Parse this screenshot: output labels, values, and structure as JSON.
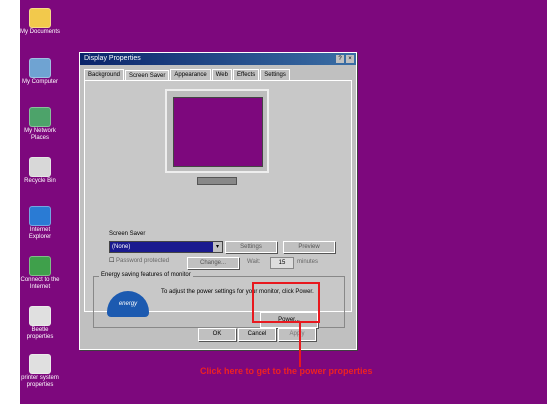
{
  "desktop": {
    "icons": [
      {
        "label": "My Documents",
        "icon": "folder-icon",
        "color": "#f2c94c"
      },
      {
        "label": "My Computer",
        "icon": "computer-icon",
        "color": "#6fa3d2"
      },
      {
        "label": "My Network Places",
        "icon": "network-icon",
        "color": "#4da36a"
      },
      {
        "label": "Recycle Bin",
        "icon": "recycle-bin-icon",
        "color": "#d8d8d8"
      },
      {
        "label": "Internet Explorer",
        "icon": "internet-explorer-icon",
        "color": "#2a7bd4"
      },
      {
        "label": "Connect to the Internet",
        "icon": "connect-internet-icon",
        "color": "#3fa04b"
      },
      {
        "label": "Beetle properties",
        "icon": "beetle-icon",
        "color": "#e0e0e0"
      },
      {
        "label": "printer system properties",
        "icon": "printer-icon",
        "color": "#e0e0e0"
      }
    ]
  },
  "dialog": {
    "title": "Display Properties",
    "title_buttons": [
      "?",
      "×"
    ],
    "tabs": [
      "Background",
      "Screen Saver",
      "Appearance",
      "Web",
      "Effects",
      "Settings"
    ],
    "active_tab": "Screen Saver",
    "screen_saver_label": "Screen Saver",
    "screen_saver_value": "(None)",
    "settings_button": "Settings",
    "preview_button": "Preview",
    "password_protected_label": "Password protected",
    "change_button": "Change...",
    "wait_label": "Wait:",
    "wait_value": "15",
    "minutes_label": "minutes",
    "energy_group_title": "Energy saving features of monitor",
    "energy_logo_text": "energy",
    "energy_text": "To adjust the power settings for your monitor, click Power.",
    "power_button": "Power...",
    "ok_button": "OK",
    "cancel_button": "Cancel",
    "apply_button": "Apply"
  },
  "annotation": {
    "caption": "Click here to get to the power properties",
    "color": "#e8181e"
  },
  "colors": {
    "desktop_bg": "#7d087d",
    "titlebar": "#0a246a",
    "dialog_face": "#c0c0c0"
  }
}
